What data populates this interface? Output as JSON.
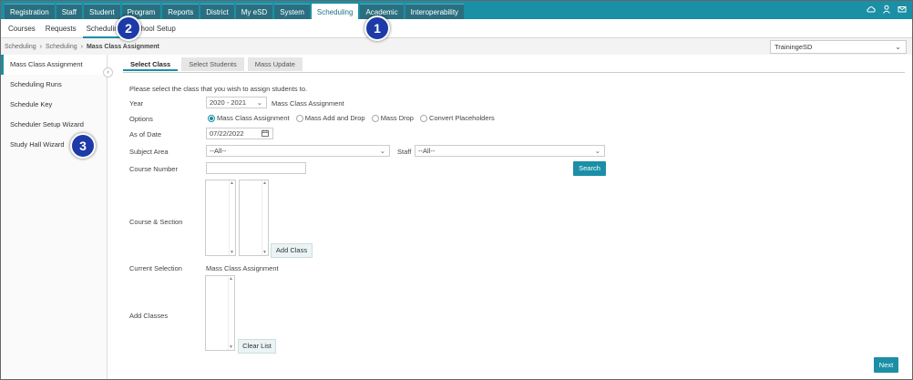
{
  "top_nav": {
    "tabs": [
      "Registration",
      "Staff",
      "Student",
      "Program",
      "Reports",
      "District",
      "My eSD",
      "System",
      "Scheduling",
      "Academic",
      "Interoperability"
    ],
    "active": "Scheduling",
    "icons": [
      "cloud-icon",
      "user-icon",
      "mail-icon"
    ]
  },
  "sub_nav": {
    "items": [
      "Courses",
      "Requests",
      "Scheduling",
      "School Setup"
    ],
    "active": "Scheduling"
  },
  "breadcrumb": [
    "Scheduling",
    "Scheduling",
    "Mass Class Assignment"
  ],
  "district": {
    "value": "TrainingeSD"
  },
  "sidebar": {
    "items": [
      "Mass Class Assignment",
      "Scheduling Runs",
      "Schedule Key",
      "Scheduler Setup Wizard",
      "Study Hall Wizard"
    ],
    "active": "Mass Class Assignment"
  },
  "subtabs": {
    "items": [
      "Select Class",
      "Select Students",
      "Mass Update"
    ],
    "active": "Select Class"
  },
  "form": {
    "instruction": "Please select the class that you wish to assign students to.",
    "year_label": "Year",
    "year_value": "2020 - 2021",
    "year_desc": "Mass Class Assignment",
    "options_label": "Options",
    "options": [
      "Mass Class Assignment",
      "Mass Add and Drop",
      "Mass Drop",
      "Convert Placeholders"
    ],
    "asof_label": "As of Date",
    "asof_value": "07/22/2022",
    "subject_label": "Subject Area",
    "subject_value": "--All--",
    "staff_label": "Staff",
    "staff_value": "--All--",
    "course_number_label": "Course Number",
    "course_number_value": "",
    "search_button": "Search",
    "course_section_label": "Course & Section",
    "add_class_button": "Add Class",
    "current_selection_label": "Current Selection",
    "current_selection_value": "Mass Class Assignment",
    "add_classes_label": "Add Classes",
    "clear_list_button": "Clear List",
    "next_button": "Next"
  },
  "callouts": [
    "1",
    "2",
    "3"
  ],
  "colors": {
    "accent": "#1b8fa6",
    "callout": "#1d3aa8"
  }
}
